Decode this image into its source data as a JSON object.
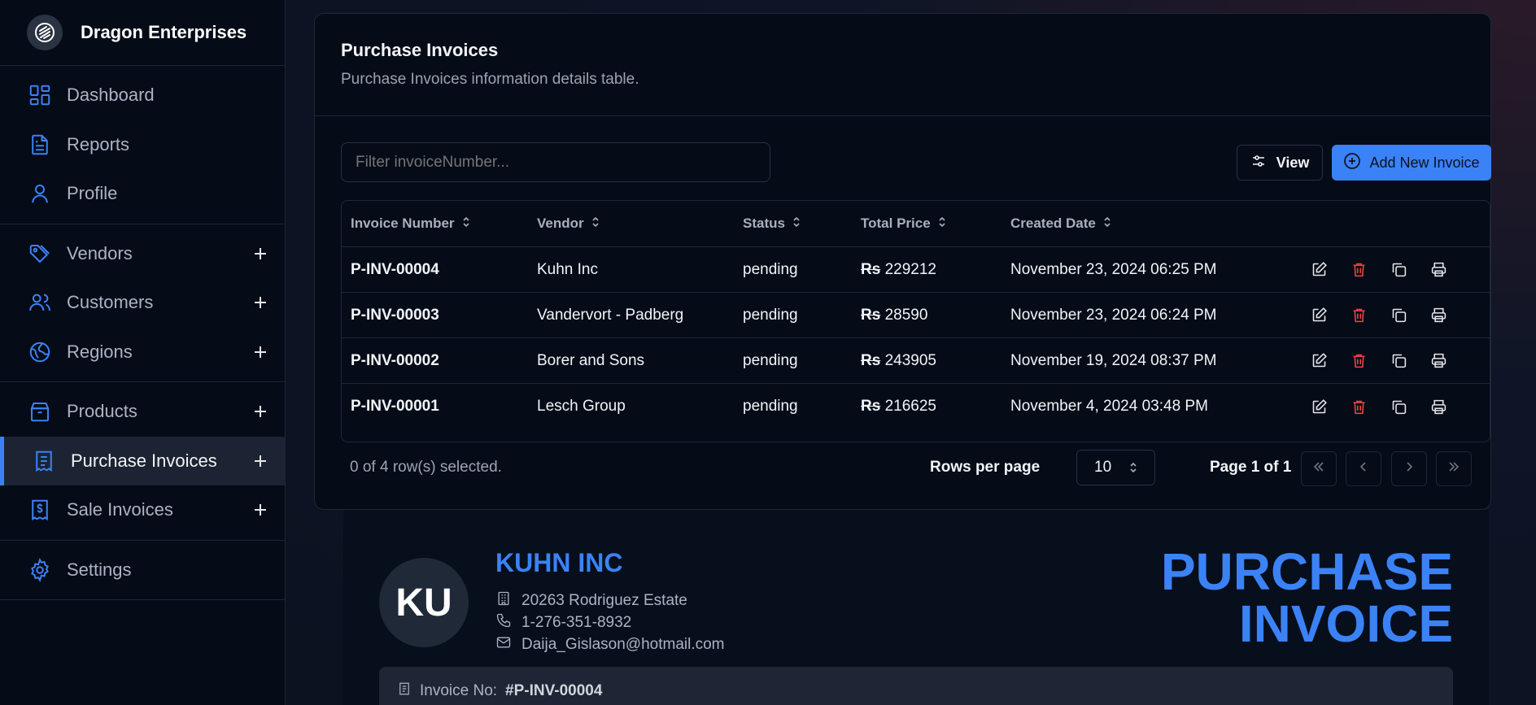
{
  "brand": {
    "name": "Dragon Enterprises"
  },
  "sidebar": {
    "items": [
      {
        "label": "Dashboard",
        "icon": "dashboard-icon"
      },
      {
        "label": "Reports",
        "icon": "document-icon"
      },
      {
        "label": "Profile",
        "icon": "user-icon"
      },
      {
        "label": "Vendors",
        "icon": "tag-icon"
      },
      {
        "label": "Customers",
        "icon": "users-icon"
      },
      {
        "label": "Regions",
        "icon": "globe-icon"
      },
      {
        "label": "Products",
        "icon": "box-icon"
      },
      {
        "label": "Purchase Invoices",
        "icon": "receipt-icon",
        "active": true
      },
      {
        "label": "Sale Invoices",
        "icon": "dollar-receipt-icon"
      },
      {
        "label": "Settings",
        "icon": "gear-icon"
      }
    ]
  },
  "card": {
    "title": "Purchase Invoices",
    "subtitle": "Purchase Invoices information details table."
  },
  "toolbar": {
    "filter_placeholder": "Filter invoiceNumber...",
    "view_label": "View",
    "add_label": "Add New Invoice"
  },
  "table": {
    "columns": [
      "Invoice Number",
      "Vendor",
      "Status",
      "Total Price",
      "Created Date"
    ],
    "currency": "Rs",
    "rows": [
      {
        "invoice": "P-INV-00004",
        "vendor": "Kuhn Inc",
        "status": "pending",
        "total": "229212",
        "date": "November 23, 2024 06:25 PM"
      },
      {
        "invoice": "P-INV-00003",
        "vendor": "Vandervort - Padberg",
        "status": "pending",
        "total": "28590",
        "date": "November 23, 2024 06:24 PM"
      },
      {
        "invoice": "P-INV-00002",
        "vendor": "Borer and Sons",
        "status": "pending",
        "total": "243905",
        "date": "November 19, 2024 08:37 PM"
      },
      {
        "invoice": "P-INV-00001",
        "vendor": "Lesch Group",
        "status": "pending",
        "total": "216625",
        "date": "November 4, 2024 03:48 PM"
      }
    ]
  },
  "pagination": {
    "selected_text": "0 of 4 row(s) selected.",
    "rows_per_page_label": "Rows per page",
    "rows_per_page": "10",
    "page_label": "Page 1 of 1"
  },
  "invoice_preview": {
    "avatar_initials": "KU",
    "vendor_name": "KUHN INC",
    "address": "20263 Rodriguez Estate",
    "phone": "1-276-351-8932",
    "email": "Daija_Gislason@hotmail.com",
    "title_line1": "PURCHASE",
    "title_line2": "INVOICE",
    "invoice_no_label": "Invoice No:",
    "invoice_no_value": "#P-INV-00004"
  },
  "colors": {
    "accent": "#3b82f6",
    "danger": "#ef4444",
    "sidebar_bg": "#050b17"
  }
}
